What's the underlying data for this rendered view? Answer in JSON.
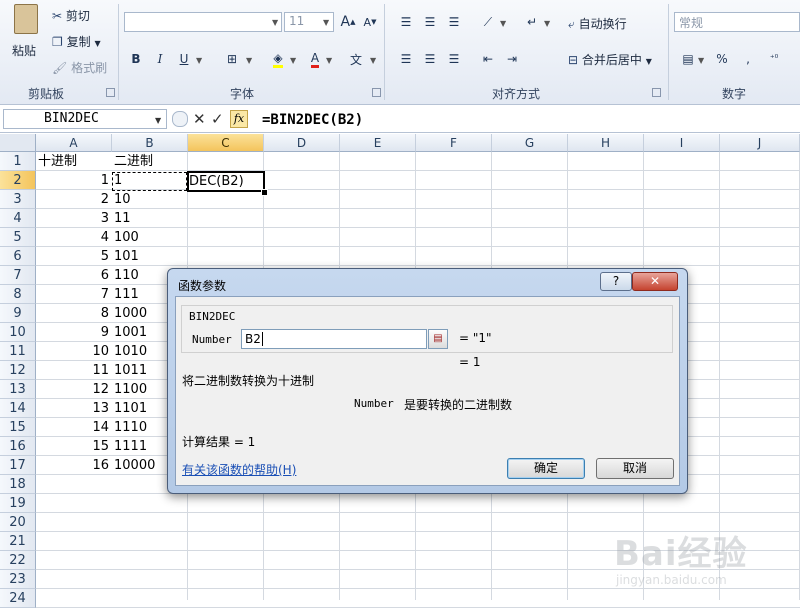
{
  "ribbon": {
    "clipboard": {
      "paste": "粘贴",
      "cut": "剪切",
      "copy": "复制",
      "format_painter": "格式刷",
      "label": "剪贴板"
    },
    "font": {
      "size": "11",
      "label": "字体",
      "bold": "B",
      "italic": "I",
      "underline": "U",
      "grow": "A",
      "shrink": "A",
      "font_color": "A",
      "phonetic": "文"
    },
    "alignment": {
      "wrap": "自动换行",
      "merge": "合并后居中",
      "label": "对齐方式"
    },
    "number": {
      "format": "常规",
      "percent": "%",
      "comma": ",",
      "label": "数字"
    }
  },
  "formula_bar": {
    "name_box": "BIN2DEC",
    "fx": "fx",
    "formula": "=BIN2DEC(B2)",
    "cancel": "✕",
    "enter": "✓"
  },
  "sheet": {
    "columns": [
      "A",
      "B",
      "C",
      "D",
      "E",
      "F",
      "G",
      "H",
      "I",
      "J"
    ],
    "rows": [
      "1",
      "2",
      "3",
      "4",
      "5",
      "6",
      "7",
      "8",
      "9",
      "10",
      "11",
      "12",
      "13",
      "14",
      "15",
      "16",
      "17",
      "18",
      "19",
      "20",
      "21",
      "22",
      "23",
      "24"
    ],
    "header_a": "十进制",
    "header_b": "二进制",
    "col_a": [
      "1",
      "2",
      "3",
      "4",
      "5",
      "6",
      "7",
      "8",
      "9",
      "10",
      "11",
      "12",
      "13",
      "14",
      "15",
      "16"
    ],
    "col_b": [
      "1",
      "10",
      "11",
      "100",
      "101",
      "110",
      "111",
      "1000",
      "1001",
      "1010",
      "1011",
      "1100",
      "1101",
      "1110",
      "1111",
      "10000"
    ],
    "editing_cell": "DEC(B2)"
  },
  "dialog": {
    "title": "函数参数",
    "help_button": "?",
    "close_button": "✕",
    "function_name": "BIN2DEC",
    "arg_label": "Number",
    "arg_value": "B2",
    "arg_result": "= \"1\"",
    "formula_result": "= 1",
    "description": "将二进制数转换为十进制",
    "arg_desc_name": "Number",
    "arg_desc_text": "是要转换的二进制数",
    "calc_result": "计算结果 =  1",
    "help_link": "有关该函数的帮助(H)",
    "ok": "确定",
    "cancel": "取消"
  },
  "watermark": {
    "logo": "Bai经验",
    "url": "jingyan.baidu.com"
  }
}
